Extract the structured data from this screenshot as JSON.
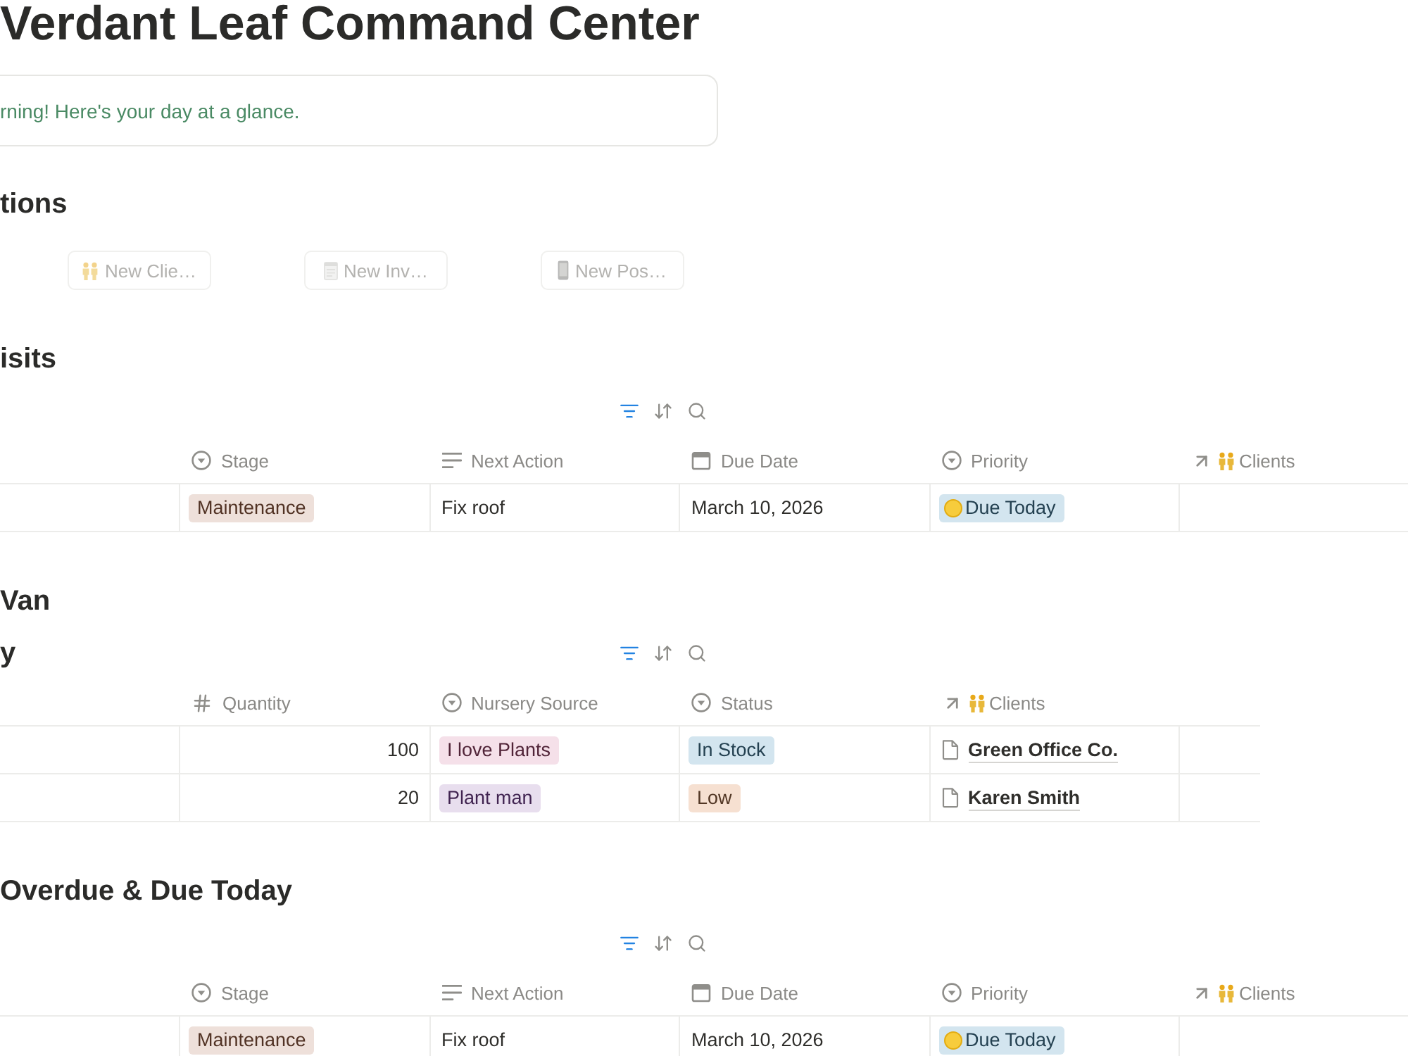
{
  "title": "Verdant Leaf Command Center",
  "callout": {
    "text": "rning! Here's your day at a glance."
  },
  "blocks": [
    {
      "kind": "heading",
      "text": "tions"
    },
    {
      "kind": "buttons",
      "buttons": [
        {
          "label": "New Clie…",
          "kind": "people"
        },
        {
          "label": "New Inv…",
          "kind": "notepad"
        },
        {
          "label": "New Pos…",
          "kind": "phone"
        }
      ]
    },
    {
      "kind": "heading",
      "text": "isits"
    },
    {
      "kind": "table",
      "filter_active": true,
      "columns": [
        {
          "label": "Stage",
          "kind": "select"
        },
        {
          "label": "Next Action",
          "kind": "text"
        },
        {
          "label": "Due Date",
          "kind": "date"
        },
        {
          "label": "Priority",
          "kind": "select"
        },
        {
          "label": "Clients",
          "kind": "relation"
        }
      ],
      "rows": [
        [
          {
            "kind": "tag",
            "text": "Maintenance",
            "color": "#eee0da"
          },
          {
            "kind": "text",
            "text": "Fix roof"
          },
          {
            "kind": "text",
            "text": "March 10, 2026"
          },
          {
            "kind": "dot-tag",
            "text": "Due Today",
            "color": "#d3e5ef"
          },
          {
            "kind": "empty"
          }
        ]
      ]
    },
    {
      "kind": "heading",
      "text": "Van"
    },
    {
      "kind": "table",
      "title": "y",
      "filter_active": true,
      "columns": [
        {
          "label": "Quantity",
          "kind": "number"
        },
        {
          "label": "Nursery Source",
          "kind": "select"
        },
        {
          "label": "Status",
          "kind": "select"
        },
        {
          "label": "Clients",
          "kind": "relation"
        }
      ],
      "rows": [
        [
          {
            "kind": "number",
            "text": "100"
          },
          {
            "kind": "tag",
            "text": "I love Plants",
            "color": "#f5e0e9"
          },
          {
            "kind": "tag",
            "text": "In Stock",
            "color": "#d3e5ef"
          },
          {
            "kind": "page",
            "text": "Green Office Co."
          }
        ],
        [
          {
            "kind": "number",
            "text": "20"
          },
          {
            "kind": "tag",
            "text": "Plant man",
            "color": "#e8deee"
          },
          {
            "kind": "tag",
            "text": "Low",
            "color": "#f6e0d1"
          },
          {
            "kind": "page",
            "text": "Karen Smith"
          }
        ]
      ]
    },
    {
      "kind": "heading",
      "text": "Overdue & Due Today"
    },
    {
      "kind": "table",
      "filter_active": true,
      "columns": [
        {
          "label": "Stage",
          "kind": "select"
        },
        {
          "label": "Next Action",
          "kind": "text"
        },
        {
          "label": "Due Date",
          "kind": "date"
        },
        {
          "label": "Priority",
          "kind": "select"
        },
        {
          "label": "Clients",
          "kind": "relation"
        }
      ],
      "rows": [
        [
          {
            "kind": "tag",
            "text": "Maintenance",
            "color": "#eee0da"
          },
          {
            "kind": "text",
            "text": "Fix roof"
          },
          {
            "kind": "text",
            "text": "March 10, 2026"
          },
          {
            "kind": "dot-tag",
            "text": "Due Today",
            "color": "#d3e5ef"
          },
          {
            "kind": "empty"
          }
        ]
      ]
    }
  ]
}
